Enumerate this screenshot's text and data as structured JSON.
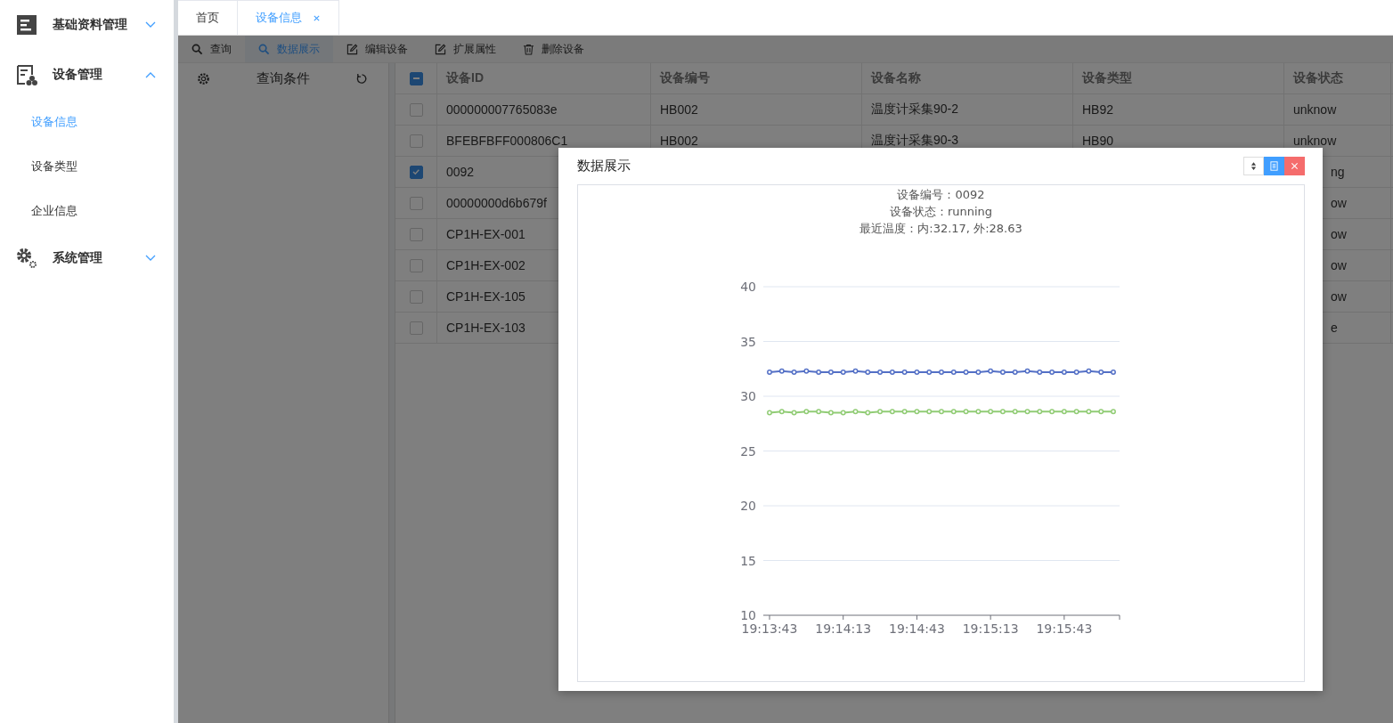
{
  "sidebar": {
    "items": [
      {
        "label": "基础资料管理",
        "expanded": false
      },
      {
        "label": "设备管理",
        "expanded": true,
        "children": [
          {
            "label": "设备信息",
            "selected": true
          },
          {
            "label": "设备类型",
            "selected": false
          },
          {
            "label": "企业信息",
            "selected": false
          }
        ]
      },
      {
        "label": "系统管理",
        "expanded": false
      }
    ]
  },
  "tabs": [
    {
      "label": "首页",
      "selected": false,
      "closable": false
    },
    {
      "label": "设备信息",
      "selected": true,
      "closable": true
    }
  ],
  "toolbar": [
    {
      "label": "查询",
      "selected": false
    },
    {
      "label": "数据展示",
      "selected": true
    },
    {
      "label": "编辑设备",
      "selected": false
    },
    {
      "label": "扩展属性",
      "selected": false
    },
    {
      "label": "删除设备",
      "selected": false
    }
  ],
  "query_panel": {
    "title": "查询条件"
  },
  "table": {
    "select_all": {
      "indeterminate": true
    },
    "columns": [
      "设备ID",
      "设备编号",
      "设备名称",
      "设备类型",
      "设备状态"
    ],
    "rows": [
      {
        "checked": false,
        "cells": [
          "000000007765083e",
          "HB002",
          "温度计采集90-2",
          "HB92",
          "unknow"
        ]
      },
      {
        "checked": false,
        "cells": [
          "BFEBFBFF000806C1",
          "HB002",
          "温度计采集90-3",
          "HB90",
          "unknow"
        ]
      },
      {
        "checked": true,
        "cells": [
          "0092",
          null,
          null,
          null,
          "ng"
        ]
      },
      {
        "checked": false,
        "cells": [
          "00000000d6b679f",
          null,
          null,
          null,
          "ow"
        ]
      },
      {
        "checked": false,
        "cells": [
          "CP1H-EX-001",
          null,
          null,
          null,
          "ow"
        ]
      },
      {
        "checked": false,
        "cells": [
          "CP1H-EX-002",
          null,
          null,
          null,
          "ow"
        ]
      },
      {
        "checked": false,
        "cells": [
          "CP1H-EX-105",
          null,
          null,
          null,
          "ow"
        ]
      },
      {
        "checked": false,
        "cells": [
          "CP1H-EX-103",
          null,
          null,
          null,
          "e"
        ]
      }
    ]
  },
  "dialog": {
    "title": "数据展示",
    "info": [
      "设备编号：0092",
      "设备状态：running",
      "最近温度：内:32.17, 外:28.63"
    ],
    "chart_data": {
      "type": "line",
      "categories": [
        "19:13:43",
        null,
        null,
        null,
        null,
        null,
        "19:14:13",
        null,
        null,
        null,
        null,
        null,
        "19:14:43",
        null,
        null,
        null,
        null,
        null,
        "19:15:13",
        null,
        null,
        null,
        null,
        null,
        "19:15:43",
        null,
        null,
        null,
        null
      ],
      "series": [
        {
          "color": "#5470c6",
          "marker": "circle",
          "values": [
            32.2,
            32.3,
            32.2,
            32.3,
            32.2,
            32.2,
            32.2,
            32.3,
            32.2,
            32.2,
            32.2,
            32.2,
            32.2,
            32.2,
            32.2,
            32.2,
            32.2,
            32.2,
            32.3,
            32.2,
            32.2,
            32.3,
            32.2,
            32.2,
            32.2,
            32.2,
            32.3,
            32.2,
            32.2
          ]
        },
        {
          "color": "#91cc75",
          "marker": "circle",
          "values": [
            28.5,
            28.6,
            28.5,
            28.6,
            28.6,
            28.5,
            28.5,
            28.6,
            28.5,
            28.6,
            28.6,
            28.6,
            28.6,
            28.6,
            28.6,
            28.6,
            28.6,
            28.6,
            28.6,
            28.6,
            28.6,
            28.6,
            28.6,
            28.6,
            28.6,
            28.6,
            28.6,
            28.6,
            28.6
          ]
        }
      ],
      "grid": true,
      "ylim": [
        10,
        40
      ],
      "yticks": [
        10,
        15,
        20,
        25,
        30,
        35,
        40
      ]
    }
  }
}
